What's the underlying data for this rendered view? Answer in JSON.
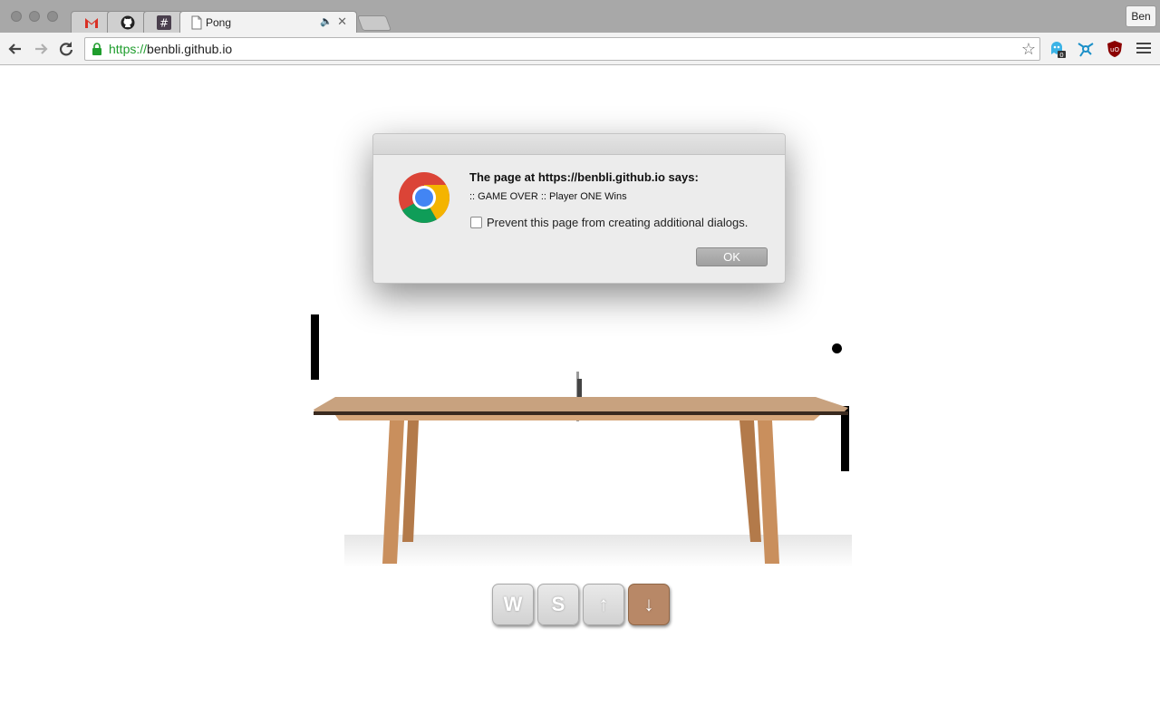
{
  "browser": {
    "tabs": [
      {
        "type": "pinned",
        "icon": "gmail-icon"
      },
      {
        "type": "pinned",
        "icon": "github-icon"
      },
      {
        "type": "pinned",
        "icon": "slack-icon"
      },
      {
        "type": "active",
        "title": "Pong",
        "icon": "page-icon",
        "audio_icon": "speaker-icon",
        "close_icon": "close-icon"
      }
    ],
    "profile_name": "Ben",
    "url_scheme": "https://",
    "url_host": "benbli.github.io",
    "extensions": [
      {
        "icon": "ghostery-icon",
        "badge": "0"
      },
      {
        "icon": "network-icon"
      },
      {
        "icon": "ublock-icon"
      }
    ],
    "accent_colors": {
      "secure": "#1f9d2d"
    }
  },
  "dialog": {
    "heading": "The page at https://benbli.github.io says:",
    "message": ":: GAME OVER :: Player ONE Wins",
    "checkbox_label": "Prevent this page from creating additional dialogs.",
    "checkbox_checked": false,
    "ok_label": "OK"
  },
  "game": {
    "keys": [
      {
        "label": "W",
        "pressed": false
      },
      {
        "label": "S",
        "pressed": false
      },
      {
        "label": "↑",
        "pressed": false
      },
      {
        "label": "↓",
        "pressed": true
      }
    ],
    "pressed_key_color": "#b88867"
  }
}
